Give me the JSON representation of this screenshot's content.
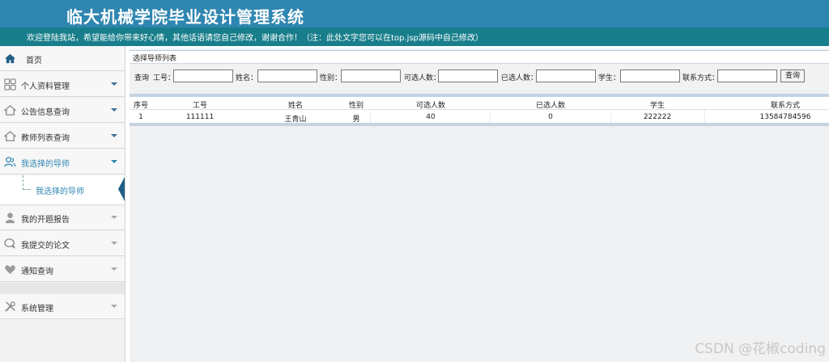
{
  "header": {
    "title": "临大机械学院毕业设计管理系统",
    "notice": "欢迎登陆我站，希望能给你带来好心情，其他话语请您自己修改，谢谢合作！（注：此处文字您可以在top.jsp源码中自己修改）"
  },
  "sidebar": {
    "items": [
      {
        "label": "首页",
        "icon": "home-icon"
      },
      {
        "label": "个人资料管理",
        "icon": "grid-icon"
      },
      {
        "label": "公告信息查询",
        "icon": "house-icon"
      },
      {
        "label": "教师列表查询",
        "icon": "house-icon"
      },
      {
        "label": "我选择的导师",
        "icon": "users-icon"
      },
      {
        "label": "我的开题报告",
        "icon": "user-icon"
      },
      {
        "label": "我提交的论文",
        "icon": "chat-icon"
      },
      {
        "label": "通知查询",
        "icon": "heart-icon"
      },
      {
        "label": "系统管理",
        "icon": "tools-icon"
      }
    ],
    "submenu": {
      "label": "我选择的导师"
    }
  },
  "main": {
    "panel_title": "选择导师列表",
    "search": {
      "query_label": "查询",
      "fields": [
        {
          "label": "工号：",
          "value": ""
        },
        {
          "label": "姓名：",
          "value": ""
        },
        {
          "label": "性别：",
          "value": ""
        },
        {
          "label": "可选人数：",
          "value": ""
        },
        {
          "label": "已选人数：",
          "value": ""
        },
        {
          "label": "学生：",
          "value": ""
        },
        {
          "label": "联系方式：",
          "value": ""
        }
      ],
      "button_label": "查询"
    },
    "table": {
      "columns": [
        "序号",
        "工号",
        "姓名",
        "性别",
        "可选人数",
        "已选人数",
        "学生",
        "联系方式"
      ],
      "rows": [
        [
          "1",
          "111111",
          "王青山",
          "男",
          "40",
          "0",
          "222222",
          "13584784596"
        ]
      ]
    }
  },
  "watermark": "CSDN @花椒coding",
  "colors": {
    "header_bg": "#2f86b1",
    "notice_bg": "#187e8b",
    "accent": "#2f86b1"
  }
}
